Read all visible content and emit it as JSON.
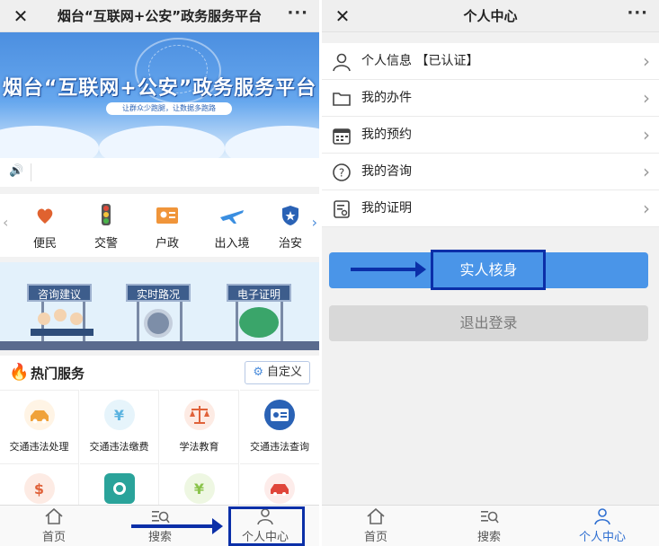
{
  "left": {
    "top_bar": {
      "title": "烟台“互联网+公安”政务服务平台",
      "close_icon": "close-icon",
      "more_icon": "more-icon"
    },
    "banner": {
      "headline": "烟台“互联网+公安”政务服务平台",
      "slogan": "让群众少跑腿，让数据多跑路"
    },
    "categories": [
      {
        "label": "便民",
        "icon": "heart-hand-icon",
        "color": "#e0622f"
      },
      {
        "label": "交警",
        "icon": "traffic-light-icon",
        "color": "#e04a3a"
      },
      {
        "label": "户政",
        "icon": "id-card-icon",
        "color": "#f0953a"
      },
      {
        "label": "出入境",
        "icon": "airplane-icon",
        "color": "#3a8ee0"
      },
      {
        "label": "治安",
        "icon": "badge-icon",
        "color": "#2a62b5"
      }
    ],
    "boards": [
      "咨询建议",
      "实时路况",
      "电子证明"
    ],
    "hot": {
      "title": "热门服务",
      "custom_label": "自定义"
    },
    "services": [
      {
        "label": "交通违法处理",
        "color": "#f0a23a"
      },
      {
        "label": "交通违法缴费",
        "color": "#5ab3e0"
      },
      {
        "label": "学法教育",
        "color": "#e0623a"
      },
      {
        "label": "交通违法查询",
        "color": "#2a62b5"
      },
      {
        "label": "",
        "color": "#e0623a"
      },
      {
        "label": "",
        "color": "#2aa39a"
      },
      {
        "label": "",
        "color": "#8ac34a"
      },
      {
        "label": "",
        "color": "#e0453a"
      }
    ],
    "tabs": [
      {
        "label": "首页",
        "icon": "home-icon"
      },
      {
        "label": "搜索",
        "icon": "search-icon"
      },
      {
        "label": "个人中心",
        "icon": "person-icon"
      }
    ]
  },
  "right": {
    "top_bar": {
      "title": "个人中心",
      "close_icon": "close-icon",
      "more_icon": "more-icon"
    },
    "menu": [
      {
        "label": "个人信息 【已认证】",
        "icon": "person-icon"
      },
      {
        "label": "我的办件",
        "icon": "folder-icon"
      },
      {
        "label": "我的预约",
        "icon": "calendar-icon"
      },
      {
        "label": "我的咨询",
        "icon": "question-icon"
      },
      {
        "label": "我的证明",
        "icon": "certificate-icon"
      }
    ],
    "verify_label": "实人核身",
    "logout_label": "退出登录",
    "tabs": [
      {
        "label": "首页",
        "icon": "home-icon"
      },
      {
        "label": "搜索",
        "icon": "search-icon"
      },
      {
        "label": "个人中心",
        "icon": "person-icon"
      }
    ],
    "accent": "#2f6fd1"
  }
}
